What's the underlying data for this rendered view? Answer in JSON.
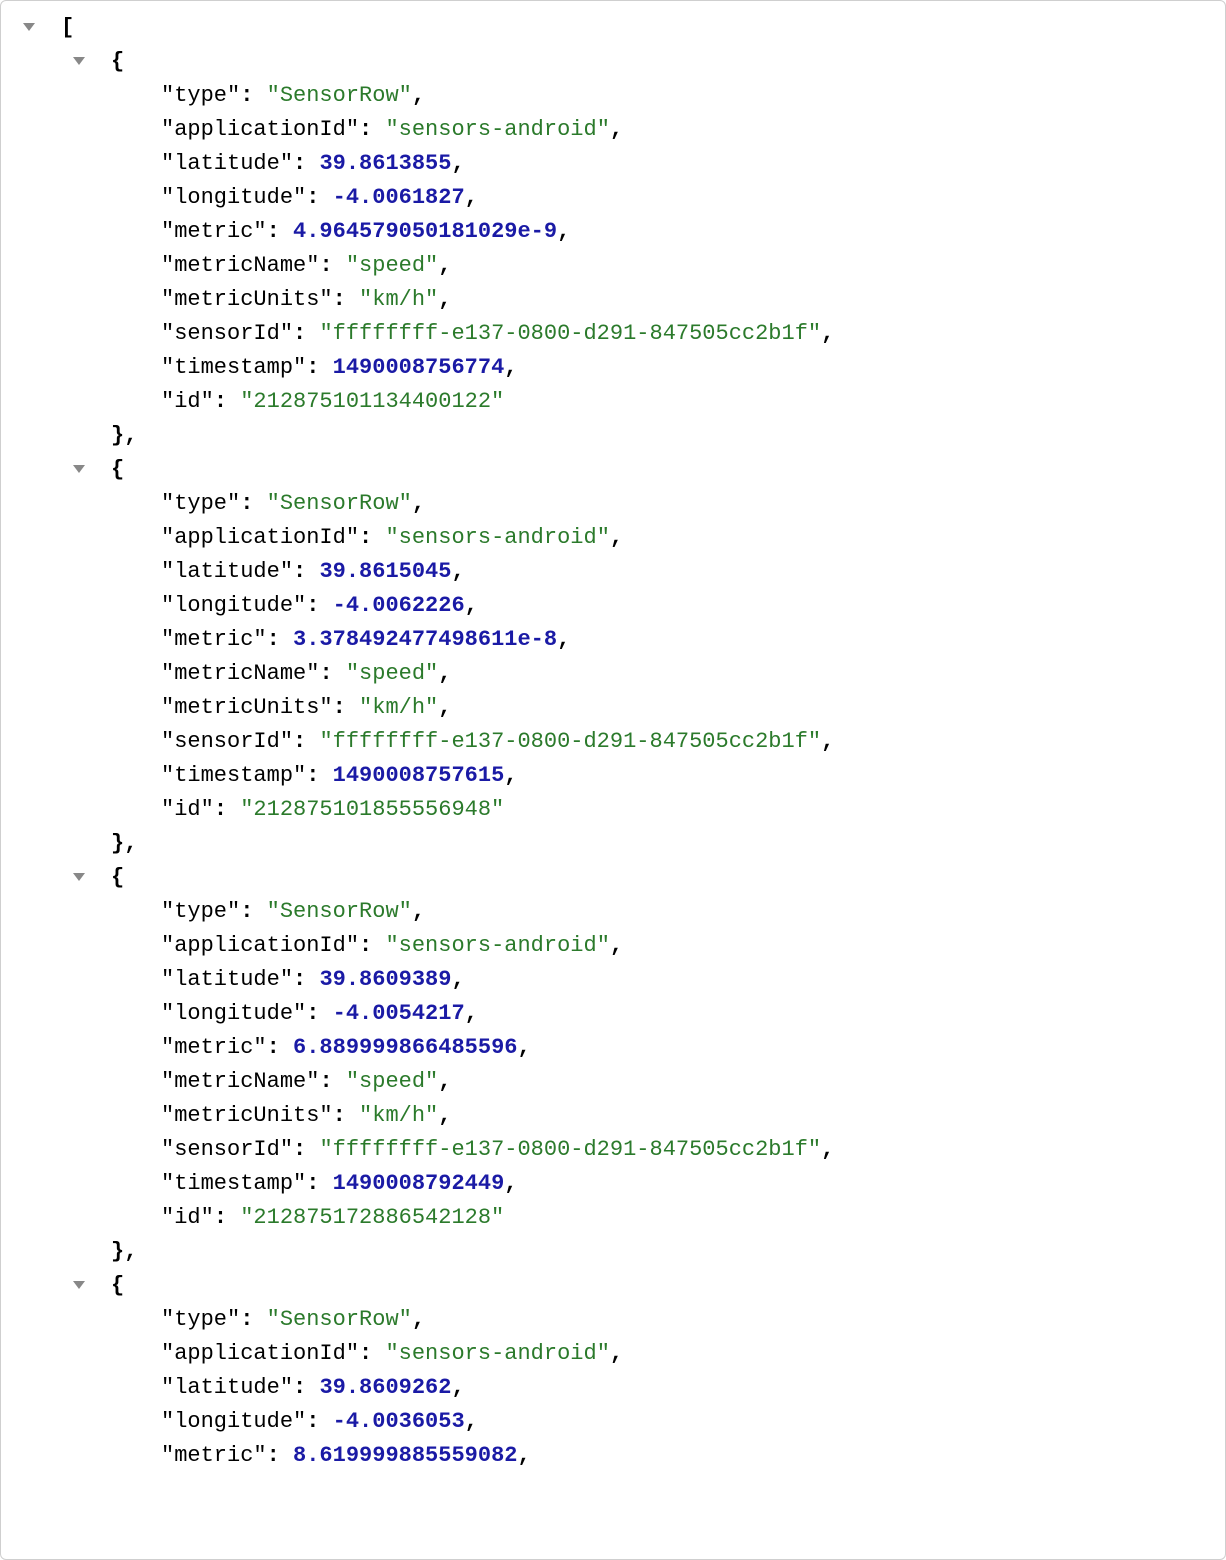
{
  "records": [
    {
      "type": "SensorRow",
      "applicationId": "sensors-android",
      "latitude": "39.8613855",
      "longitude": "-4.0061827",
      "metric": "4.964579050181029e-9",
      "metricName": "speed",
      "metricUnits": "km/h",
      "sensorId": "ffffffff-e137-0800-d291-847505cc2b1f",
      "timestamp": "1490008756774",
      "id": "212875101134400122",
      "complete": true
    },
    {
      "type": "SensorRow",
      "applicationId": "sensors-android",
      "latitude": "39.8615045",
      "longitude": "-4.0062226",
      "metric": "3.378492477498611e-8",
      "metricName": "speed",
      "metricUnits": "km/h",
      "sensorId": "ffffffff-e137-0800-d291-847505cc2b1f",
      "timestamp": "1490008757615",
      "id": "212875101855556948",
      "complete": true
    },
    {
      "type": "SensorRow",
      "applicationId": "sensors-android",
      "latitude": "39.8609389",
      "longitude": "-4.0054217",
      "metric": "6.889999866485596",
      "metricName": "speed",
      "metricUnits": "km/h",
      "sensorId": "ffffffff-e137-0800-d291-847505cc2b1f",
      "timestamp": "1490008792449",
      "id": "212875172886542128",
      "complete": true
    },
    {
      "type": "SensorRow",
      "applicationId": "sensors-android",
      "latitude": "39.8609262",
      "longitude": "-4.0036053",
      "metric": "8.619999885559082",
      "complete": false
    }
  ],
  "fieldOrder": [
    "type",
    "applicationId",
    "latitude",
    "longitude",
    "metric",
    "metricName",
    "metricUnits",
    "sensorId",
    "timestamp",
    "id"
  ],
  "numericFields": [
    "latitude",
    "longitude",
    "metric",
    "timestamp"
  ],
  "glyphs": {
    "open_bracket": "[",
    "open_brace": "{",
    "close_brace": "}",
    "quote": "\"",
    "colon": ":",
    "comma": ","
  }
}
